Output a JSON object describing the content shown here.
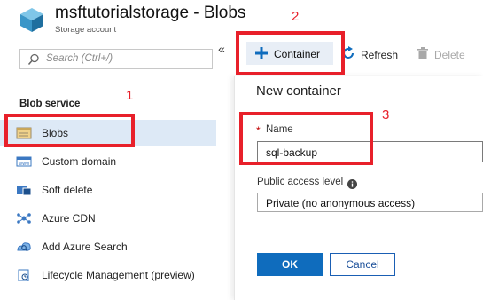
{
  "header": {
    "title": "msftutorialstorage - Blobs",
    "subtitle": "Storage account"
  },
  "sidebar": {
    "search_placeholder": "Search (Ctrl+/)",
    "collapse_glyph": "«",
    "section_label": "Blob service",
    "items": [
      {
        "label": "Blobs",
        "icon": "blobs-icon",
        "selected": true
      },
      {
        "label": "Custom domain",
        "icon": "custom-domain-icon"
      },
      {
        "label": "Soft delete",
        "icon": "soft-delete-icon"
      },
      {
        "label": "Azure CDN",
        "icon": "cdn-icon"
      },
      {
        "label": "Add Azure Search",
        "icon": "azure-search-icon"
      },
      {
        "label": "Lifecycle Management (preview)",
        "icon": "lifecycle-icon"
      }
    ]
  },
  "toolbar": {
    "container_label": "Container",
    "refresh_label": "Refresh",
    "delete_label": "Delete"
  },
  "panel": {
    "title": "New container",
    "required_mark": "*",
    "name_label": "Name",
    "name_value": "sql-backup",
    "access_label": "Public access level",
    "access_value": "Private (no anonymous access)",
    "ok_label": "OK",
    "cancel_label": "Cancel"
  },
  "annotations": {
    "step1": "1",
    "step2": "2",
    "step3": "3"
  },
  "colors": {
    "accent": "#0f6cbd",
    "selected_bg": "#dde9f6",
    "annotation_red": "#e8202a"
  }
}
